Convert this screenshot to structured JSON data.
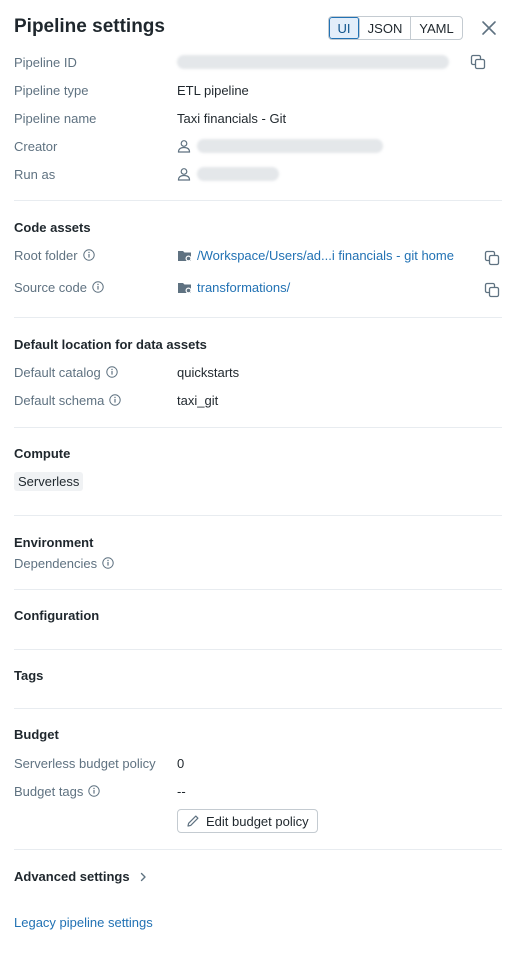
{
  "header": {
    "title": "Pipeline settings",
    "view_modes": [
      "UI",
      "JSON",
      "YAML"
    ],
    "active_mode": "UI",
    "close_icon": "close-icon"
  },
  "general": {
    "pipeline_id_label": "Pipeline ID",
    "pipeline_type_label": "Pipeline type",
    "pipeline_type": "ETL pipeline",
    "pipeline_name_label": "Pipeline name",
    "pipeline_name": "Taxi financials - Git",
    "creator_label": "Creator",
    "run_as_label": "Run as"
  },
  "code_assets": {
    "title": "Code assets",
    "root_folder_label": "Root folder",
    "root_folder": "/Workspace/Users/ad...i financials - git home",
    "source_code_label": "Source code",
    "source_code": "transformations/"
  },
  "default_location": {
    "title": "Default location for data assets",
    "catalog_label": "Default catalog",
    "catalog": "quickstarts",
    "schema_label": "Default schema",
    "schema": "taxi_git"
  },
  "compute": {
    "title": "Compute",
    "value": "Serverless"
  },
  "environment": {
    "title": "Environment",
    "dependencies_label": "Dependencies"
  },
  "configuration": {
    "title": "Configuration"
  },
  "tags": {
    "title": "Tags"
  },
  "budget": {
    "title": "Budget",
    "policy_label": "Serverless budget policy",
    "policy_value": "0",
    "tags_label": "Budget tags",
    "tags_value": "--",
    "edit_button": "Edit budget policy"
  },
  "advanced": {
    "label": "Advanced settings"
  },
  "legacy": {
    "label": "Legacy pipeline settings"
  },
  "colors": {
    "accent": "#2272b4",
    "label": "#5f7281",
    "text": "#1f272d",
    "divider": "#e8ecf0"
  }
}
